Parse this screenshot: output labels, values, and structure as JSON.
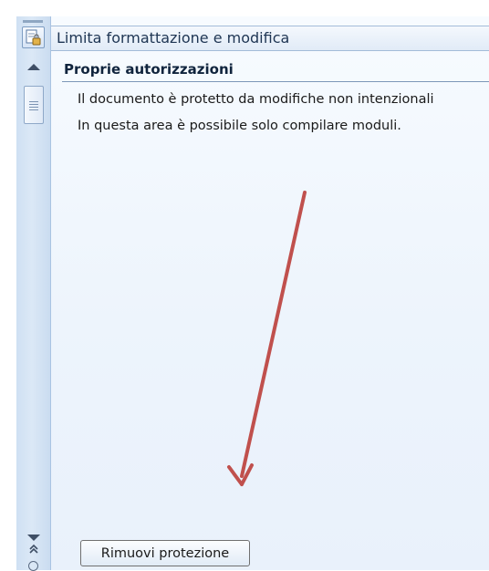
{
  "task_pane": {
    "title": "Limita formattazione e modifica",
    "section_heading": "Proprie autorizzazioni",
    "lines": [
      "Il documento è protetto da modifiche non intenzionali",
      "In questa area è possibile solo compilare moduli."
    ],
    "remove_button_label": "Rimuovi protezione"
  },
  "icons": {
    "pane": "restrict-editing-icon",
    "scroll_up": "scroll-up-arrow-icon",
    "scroll_down": "scroll-down-arrow-icon",
    "nav_up": "previous-page-icon",
    "nav_select": "select-browse-object-icon",
    "annotation": "red-arrow-annotation"
  },
  "colors": {
    "annotation_arrow": "#c0504d",
    "pane_background": "#edf4fc",
    "header_text": "#1e3553"
  }
}
